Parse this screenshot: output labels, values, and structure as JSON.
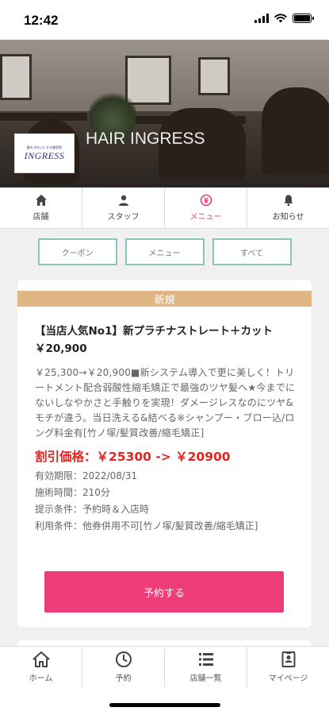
{
  "status_bar": {
    "time": "12:42"
  },
  "hero": {
    "caption": "HAIR INGRESS",
    "logo_small": "髪をきれいにする美容院",
    "logo_name": "INGRESS"
  },
  "top_tabs": [
    {
      "label": "店舗",
      "icon": "home-icon"
    },
    {
      "label": "スタッフ",
      "icon": "person-icon"
    },
    {
      "label": "メニュー",
      "icon": "yen-icon",
      "active": true
    },
    {
      "label": "お知らせ",
      "icon": "bell-icon"
    }
  ],
  "filters": [
    "クーポン",
    "メニュー",
    "すべて"
  ],
  "card": {
    "badge": "新規",
    "title": "【当店人気No1】新プラチナストレート＋カット ￥20,900",
    "description": "￥25,300→￥20,900■新システム導入で更に美しく！トリートメント配合弱酸性縮毛矯正で最強のツヤ髪へ★今までにないしなやかさと手触りを実現！ダメージレスなのにツヤ&モチが違う。当日洗える&結べる※シャンプー・ブロー込/ロング料金有[竹ノ塚/髪質改善/縮毛矯正]",
    "price": "割引価格：￥25300 -> ￥20900",
    "validity": "有効期限：2022/08/31",
    "duration": "施術時間：210分",
    "condition": "提示条件：予約時＆入店時",
    "usage": "利用条件：他券併用不可[竹ノ塚/髪質改善/縮毛矯正]",
    "reserve_label": "予約する"
  },
  "bottom_nav": [
    {
      "label": "ホーム",
      "icon": "home-icon"
    },
    {
      "label": "予約",
      "icon": "clock-icon"
    },
    {
      "label": "店舗一覧",
      "icon": "list-icon"
    },
    {
      "label": "マイページ",
      "icon": "id-card-icon"
    }
  ],
  "colors": {
    "accent": "#ee3c78",
    "badge": "#e0b784",
    "filter_border": "#88c5bf",
    "price": "#e5241f"
  }
}
